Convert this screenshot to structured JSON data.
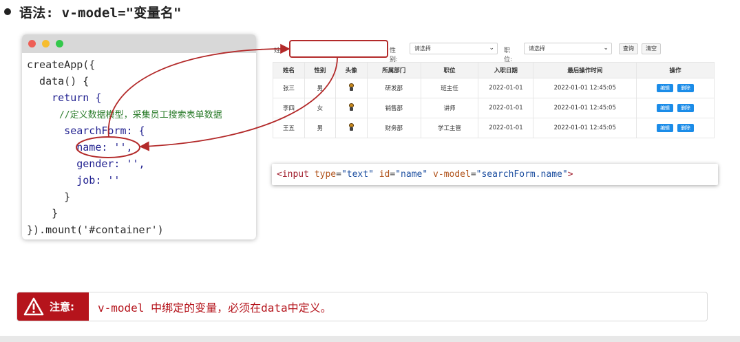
{
  "heading": {
    "text": "语法: v-model=\"变量名\""
  },
  "code": {
    "lines": [
      "createApp({",
      "  data() {",
      "    return {",
      "      //定义数据模型，采集员工搜索表单数据",
      "      searchForm: {",
      "        name: '',",
      "        gender: '',",
      "        job: ''",
      "      }",
      "    }",
      "}).mount('#container')"
    ]
  },
  "form": {
    "name_label": "姓",
    "gender_label": "性别:",
    "gender_placeholder": "请选择",
    "job_label": "职位:",
    "job_placeholder": "请选择",
    "query_button": "查询",
    "clear_button": "清空"
  },
  "table": {
    "headers": [
      "姓名",
      "性别",
      "头像",
      "所属部门",
      "职位",
      "入职日期",
      "最后操作时间",
      "操作"
    ],
    "rows": [
      {
        "name": "张三",
        "gender": "男",
        "dept": "研发部",
        "job": "班主任",
        "date": "2022-01-01",
        "updated": "2022-01-01 12:45:05"
      },
      {
        "name": "李四",
        "gender": "女",
        "dept": "销售部",
        "job": "讲师",
        "date": "2022-01-01",
        "updated": "2022-01-01 12:45:05"
      },
      {
        "name": "王五",
        "gender": "男",
        "dept": "财务部",
        "job": "学工主管",
        "date": "2022-01-01",
        "updated": "2022-01-01 12:45:05"
      }
    ],
    "edit_label": "编辑",
    "delete_label": "删除"
  },
  "snippet": {
    "tag_open": "<input",
    "attr_type": "type",
    "val_type": "\"text\"",
    "attr_id": "id",
    "val_id": "\"name\"",
    "attr_model": "v-model",
    "val_model": "\"searchForm.name\"",
    "tag_close": ">"
  },
  "notice": {
    "label": "注意:",
    "text": "v-model 中绑定的变量，必须在data中定义。"
  },
  "colors": {
    "accent_red": "#b5141c",
    "button_blue": "#1b8ce8",
    "annotation_red": "#b32a2a"
  }
}
